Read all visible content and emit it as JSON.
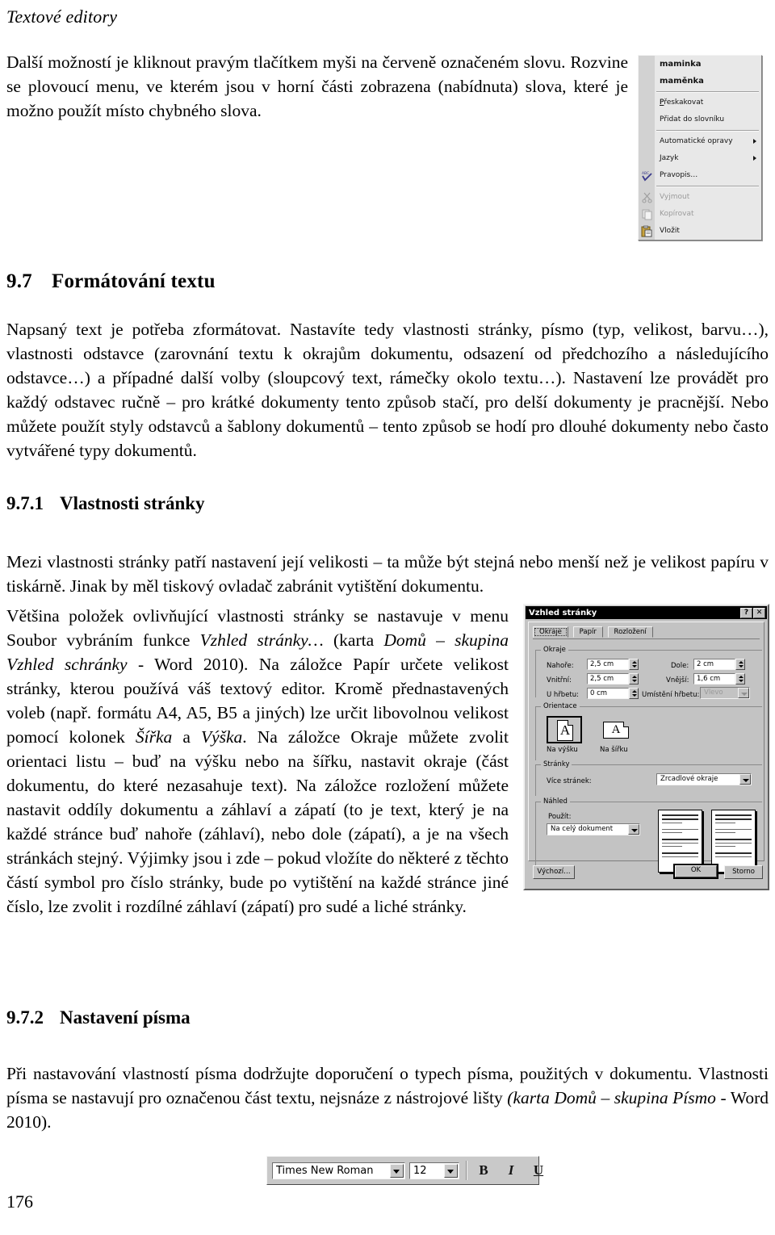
{
  "document": {
    "running_head": "Textové editory",
    "folio": "176",
    "intro_paragraph": "Další možností je kliknout pravým tlačítkem myši na červeně označeném slovu. Rozvine se plovoucí menu, ve kterém jsou v horní části zobrazena (nabídnuta) slova, které je možno použít místo chybného slova.",
    "heading_97": {
      "number": "9.7",
      "title": "Formátování textu"
    },
    "paragraph_97": "Napsaný text je potřeba zformátovat. Nastavíte tedy vlastnosti stránky, písmo (typ, velikost, barvu…), vlastnosti odstavce (zarovnání textu k okrajům dokumentu, odsazení od předchozího a následujícího odstavce…) a případné další volby (sloupcový text, rámečky okolo textu…). Nastavení lze provádět pro každý odstavec ručně – pro krátké dokumenty tento způsob stačí, pro delší dokumenty je pracnější. Nebo můžete použít styly odstavců a šablony dokumentů – tento způsob se hodí pro dlouhé dokumenty nebo často vytvářené typy dokumentů.",
    "heading_971": {
      "number": "9.7.1",
      "title": "Vlastnosti stránky"
    },
    "paragraph_971": "Mezi vlastnosti stránky patří nastavení její velikosti – ta může být stejná nebo menší než je velikost papíru v tiskárně. Jinak by měl tiskový ovladač zabránit vytištění dokumentu.",
    "wrapped_paragraph": {
      "seg1": "Většina položek ovlivňující vlastnosti stránky se nastavuje v menu Soubor vybráním funkce ",
      "seg2_italic": "Vzhled stránky…",
      "seg3": " (karta ",
      "seg4_italic": "Domů – skupina Vzhled schránky",
      "seg5": " - Word 2010). Na záložce Papír určete velikost stránky, kterou používá váš textový editor. Kromě přednastavených voleb (např. formátu A4, A5, B5 a jiných) lze určit libovolnou velikost pomocí kolonek ",
      "seg6_italic": "Šířka",
      "seg7": " a ",
      "seg8_italic": "Výška",
      "seg9": ". Na záložce Okraje můžete zvolit orientaci listu – buď na výšku nebo na šířku, nastavit okraje (část dokumentu, do které nezasahuje text). Na záložce rozložení můžete nastavit oddíly dokumentu a záhlaví a zápatí (to je text, který je na každé stránce buď nahoře (záhlaví), nebo dole (zápatí), a je na všech stránkách stejný. Výjimky jsou i zde – pokud vložíte do některé z těchto částí symbol pro číslo stránky, bude po vytištění na každé stránce jiné číslo, lze zvolit i rozdílné záhlaví (zápatí) pro sudé a liché stránky."
    },
    "heading_972": {
      "number": "9.7.2",
      "title": "Nastavení písma"
    },
    "paragraph_972": {
      "seg1": "Při nastavování vlastností písma dodržujte doporučení o typech písma, použitých v dokumentu. Vlastnosti písma se nastavují pro označenou část textu, nejsnáze z nástrojové lišty ",
      "seg2_italic": "(karta Domů – skupina Písmo",
      "seg3": " - Word 2010)."
    }
  },
  "context_menu": {
    "items": [
      {
        "label": "maminka",
        "style": "bold",
        "icon": "",
        "submenu": false,
        "disabled": false
      },
      {
        "label": "maměnka",
        "style": "bold",
        "icon": "",
        "submenu": false,
        "disabled": false
      },
      {
        "label": "Přeskakovat",
        "style": "normal",
        "icon": "",
        "submenu": false,
        "disabled": false
      },
      {
        "label": "Přidat do slovníku",
        "style": "normal",
        "icon": "",
        "submenu": false,
        "disabled": false
      },
      {
        "label": "Automatické opravy",
        "style": "normal",
        "icon": "",
        "submenu": true,
        "disabled": false
      },
      {
        "label": "Jazyk",
        "style": "normal",
        "icon": "",
        "submenu": true,
        "disabled": false
      },
      {
        "label": "Pravopis…",
        "style": "normal",
        "icon": "spellcheck-icon",
        "submenu": false,
        "disabled": false
      },
      {
        "label": "Vyjmout",
        "style": "normal",
        "icon": "cut-icon",
        "submenu": false,
        "disabled": true
      },
      {
        "label": "Kopírovat",
        "style": "normal",
        "icon": "copy-icon",
        "submenu": false,
        "disabled": true
      },
      {
        "label": "Vložit",
        "style": "normal",
        "icon": "paste-icon",
        "submenu": false,
        "disabled": false
      }
    ]
  },
  "page_setup_dialog": {
    "title": "Vzhled stránky",
    "help_button": "?",
    "close_button": "✕",
    "tabs": [
      {
        "label": "Okraje",
        "active": true
      },
      {
        "label": "Papír",
        "active": false
      },
      {
        "label": "Rozložení",
        "active": false
      }
    ],
    "margins_group": {
      "legend": "Okraje",
      "top_label": "Nahoře:",
      "top_value": "2,5 cm",
      "bottom_label": "Dole:",
      "bottom_value": "2 cm",
      "inside_label": "Vnitřní:",
      "inside_value": "2,5 cm",
      "outside_label": "Vnější:",
      "outside_value": "1,6 cm",
      "gutter_label": "U hřbetu:",
      "gutter_value": "0 cm",
      "gutter_pos_label": "Umístění hřbetu:",
      "gutter_pos_value": "Vlevo"
    },
    "orientation_group": {
      "legend": "Orientace",
      "portrait_label": "Na výšku",
      "landscape_label": "Na šířku",
      "glyph": "A",
      "selected": "portrait"
    },
    "pages_group": {
      "legend": "Stránky",
      "multiple_label": "Více stránek:",
      "multiple_value": "Zrcadlové okraje"
    },
    "preview_group": {
      "legend": "Náhled",
      "apply_label": "Použít:",
      "apply_value": "Na celý dokument"
    },
    "buttons": {
      "default": "Výchozí…",
      "ok": "OK",
      "cancel": "Storno"
    }
  },
  "font_toolbar": {
    "font_name": "Times New Roman",
    "font_size": "12",
    "bold_label": "B",
    "italic_label": "I",
    "underline_label": "U"
  }
}
